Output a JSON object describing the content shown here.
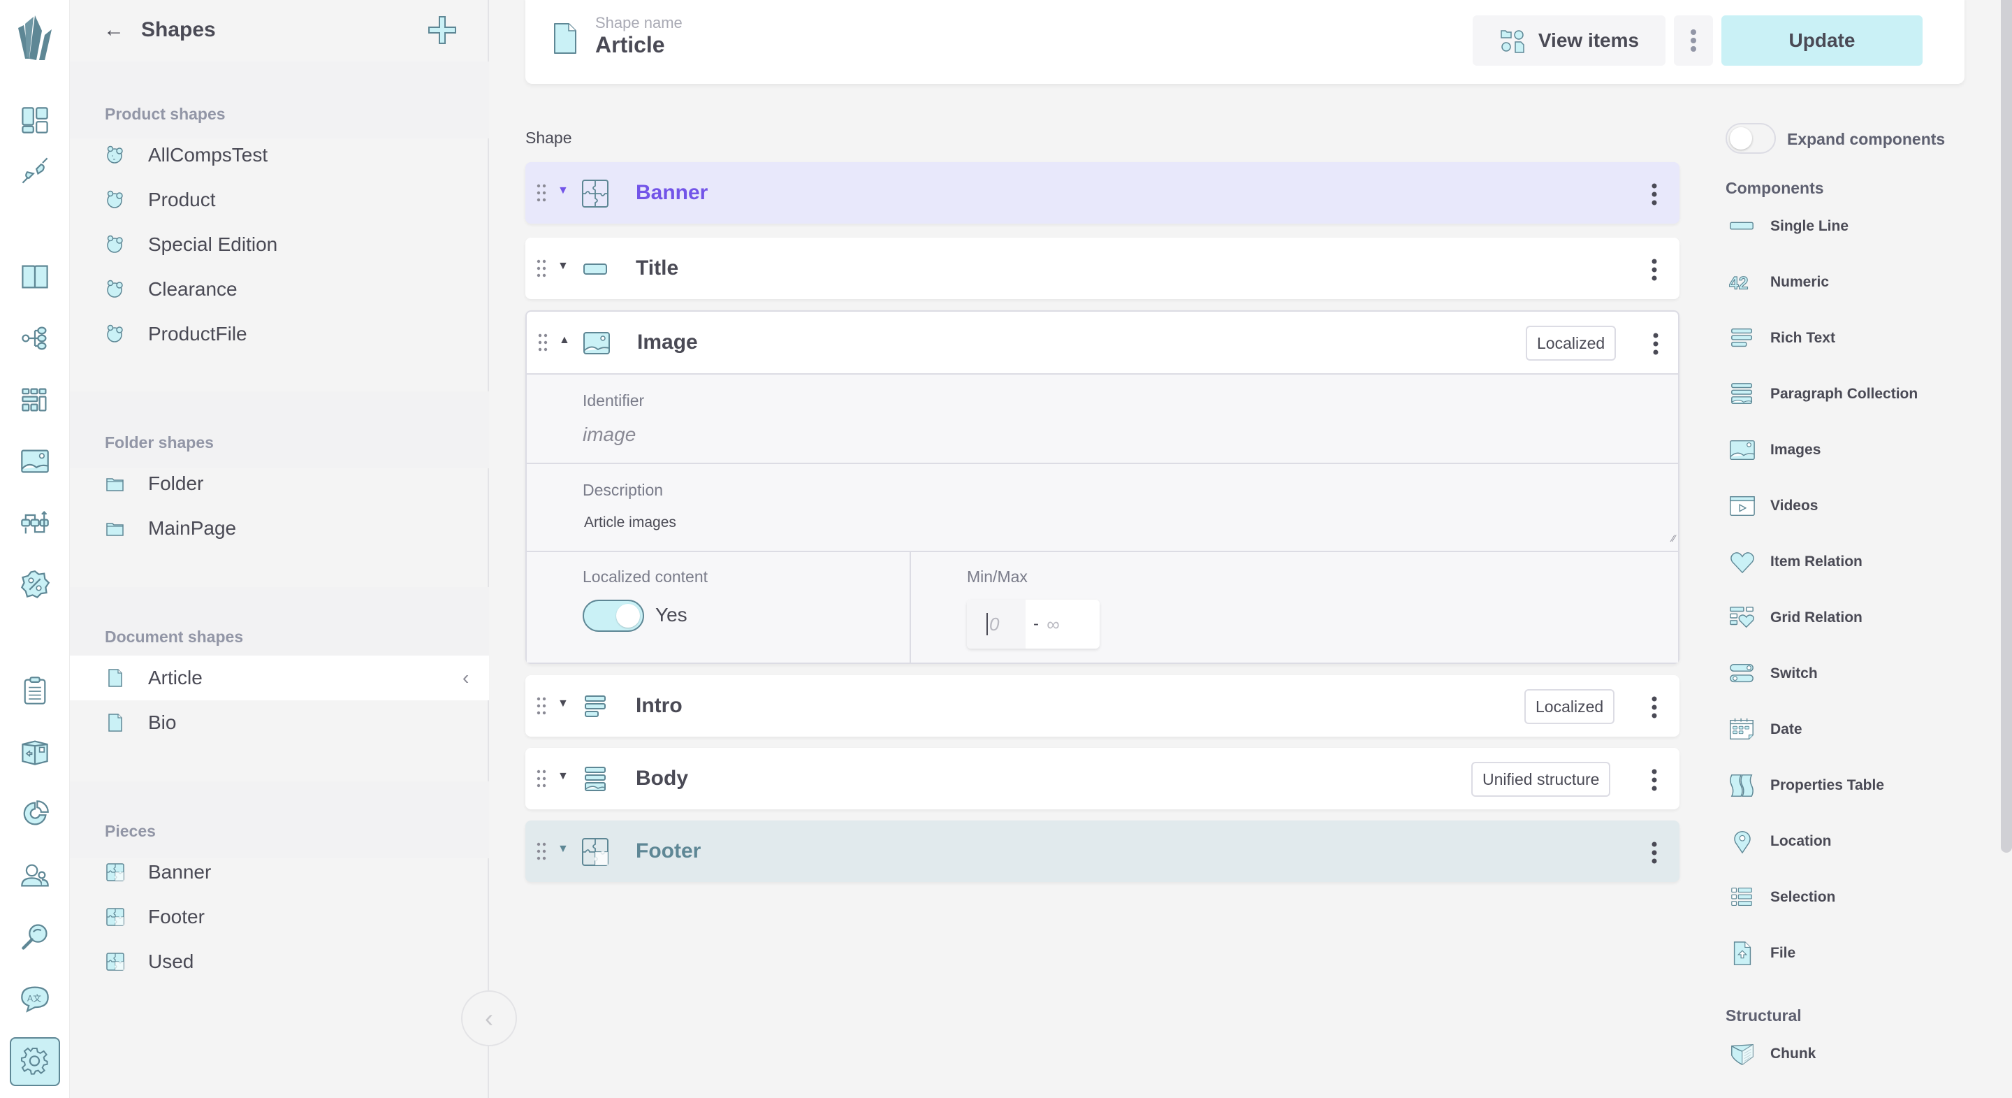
{
  "rail": {
    "logo": "crystallize-logo",
    "items": [
      {
        "name": "dashboard",
        "icon": "dashboard-icon",
        "active": false
      },
      {
        "name": "integrations",
        "icon": "plug-icon",
        "active": false
      },
      {
        "name": "catalogue",
        "icon": "book-icon",
        "active": false
      },
      {
        "name": "topics",
        "icon": "tree-icon",
        "active": false
      },
      {
        "name": "grids",
        "icon": "grid-icon",
        "active": false
      },
      {
        "name": "media",
        "icon": "image-icon",
        "active": false
      },
      {
        "name": "flows",
        "icon": "flow-icon",
        "active": false
      },
      {
        "name": "discounts",
        "icon": "percent-badge-icon",
        "active": false
      },
      {
        "name": "orders",
        "icon": "clipboard-icon",
        "active": false
      },
      {
        "name": "fulfilment",
        "icon": "box-icon",
        "active": false
      },
      {
        "name": "analytics",
        "icon": "pie-chart-icon",
        "active": false
      },
      {
        "name": "customers",
        "icon": "users-icon",
        "active": false
      },
      {
        "name": "search",
        "icon": "search-icon",
        "active": false
      },
      {
        "name": "translations",
        "icon": "translate-icon",
        "active": false
      },
      {
        "name": "settings",
        "icon": "gear-icon",
        "active": true
      }
    ]
  },
  "left_panel": {
    "title": "Shapes",
    "back_icon": "←",
    "sections": [
      {
        "label": "Product shapes",
        "items": [
          {
            "label": "AllCompsTest",
            "icon": "product-shape-icon"
          },
          {
            "label": "Product",
            "icon": "product-shape-icon"
          },
          {
            "label": "Special Edition",
            "icon": "product-shape-icon"
          },
          {
            "label": "Clearance",
            "icon": "product-shape-icon"
          },
          {
            "label": "ProductFile",
            "icon": "product-shape-icon"
          }
        ]
      },
      {
        "label": "Folder shapes",
        "items": [
          {
            "label": "Folder",
            "icon": "folder-icon"
          },
          {
            "label": "MainPage",
            "icon": "folder-icon"
          }
        ]
      },
      {
        "label": "Document shapes",
        "items": [
          {
            "label": "Article",
            "icon": "document-icon",
            "selected": true
          },
          {
            "label": "Bio",
            "icon": "document-icon"
          }
        ]
      },
      {
        "label": "Pieces",
        "items": [
          {
            "label": "Banner",
            "icon": "piece-icon"
          },
          {
            "label": "Footer",
            "icon": "piece-icon"
          },
          {
            "label": "Used",
            "icon": "piece-icon"
          }
        ]
      }
    ],
    "selected_chevron": "‹",
    "collapse_chevron": "‹"
  },
  "header": {
    "shape_name_label": "Shape name",
    "shape_name_value": "Article",
    "view_items_label": "View items",
    "update_label": "Update"
  },
  "shape": {
    "label": "Shape",
    "rows": [
      {
        "name": "Banner",
        "type": "piece",
        "badge": null,
        "expanded": false,
        "highlight": "purple"
      },
      {
        "name": "Title",
        "type": "single-line",
        "badge": null,
        "expanded": false
      },
      {
        "name": "Image",
        "type": "images",
        "badge": "Localized",
        "expanded": true
      },
      {
        "name": "Intro",
        "type": "rich-text",
        "badge": "Localized",
        "expanded": false
      },
      {
        "name": "Body",
        "type": "paragraph-collection",
        "badge": "Unified structure",
        "expanded": false
      },
      {
        "name": "Footer",
        "type": "piece",
        "badge": null,
        "expanded": false,
        "highlight": "teal"
      }
    ],
    "expanded_detail": {
      "identifier_label": "Identifier",
      "identifier_value": "image",
      "description_label": "Description",
      "description_value": "Article images",
      "localized_label": "Localized content",
      "localized_value": "Yes",
      "localized_on": true,
      "minmax_label": "Min/Max",
      "min_placeholder": "0",
      "max_placeholder": "∞",
      "separator": "-"
    }
  },
  "components_panel": {
    "expand_label": "Expand components",
    "expand_on": false,
    "components_heading": "Components",
    "components": [
      {
        "label": "Single Line",
        "icon": "single-line-icon"
      },
      {
        "label": "Numeric",
        "icon": "numeric-icon"
      },
      {
        "label": "Rich Text",
        "icon": "rich-text-icon"
      },
      {
        "label": "Paragraph Collection",
        "icon": "paragraph-collection-icon"
      },
      {
        "label": "Images",
        "icon": "images-icon"
      },
      {
        "label": "Videos",
        "icon": "videos-icon"
      },
      {
        "label": "Item Relation",
        "icon": "heart-icon"
      },
      {
        "label": "Grid Relation",
        "icon": "grid-relation-icon"
      },
      {
        "label": "Switch",
        "icon": "switch-icon"
      },
      {
        "label": "Date",
        "icon": "calendar-icon"
      },
      {
        "label": "Properties Table",
        "icon": "properties-table-icon"
      },
      {
        "label": "Location",
        "icon": "location-pin-icon"
      },
      {
        "label": "Selection",
        "icon": "selection-list-icon"
      },
      {
        "label": "File",
        "icon": "file-upload-icon"
      }
    ],
    "structural_heading": "Structural",
    "structural": [
      {
        "label": "Chunk",
        "icon": "chunk-icon"
      }
    ]
  },
  "colors": {
    "accent_fill": "#caf1f6",
    "accent_stroke": "#5e8795",
    "piece_purple": "#7254e8",
    "text": "#4a4a55",
    "muted": "#9296a6"
  }
}
